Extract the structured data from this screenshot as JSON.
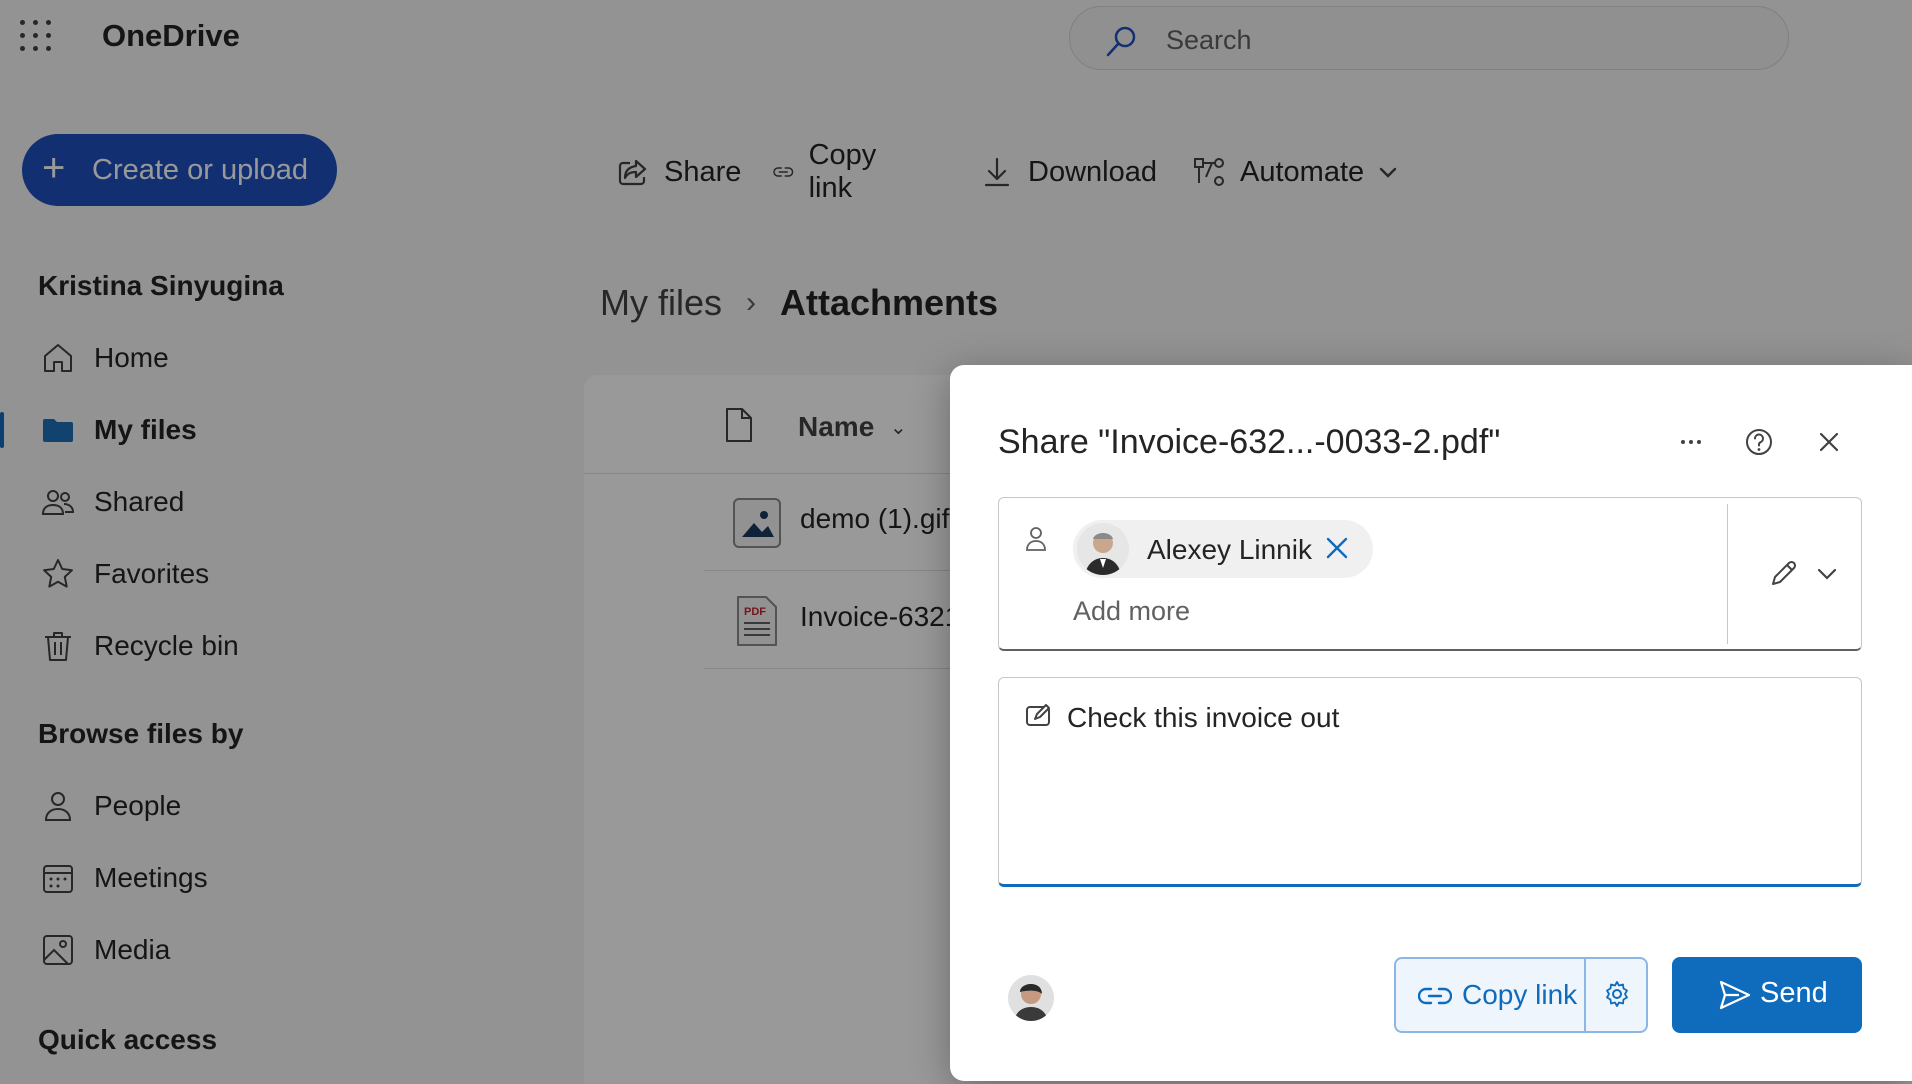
{
  "app": {
    "title": "OneDrive"
  },
  "search": {
    "placeholder": "Search"
  },
  "create": {
    "label": "Create or upload"
  },
  "toolbar": {
    "share": "Share",
    "copy_link": "Copy link",
    "download": "Download",
    "automate": "Automate"
  },
  "sidebar": {
    "user": "Kristina Sinyugina",
    "items": [
      {
        "label": "Home",
        "icon": "home-icon"
      },
      {
        "label": "My files",
        "icon": "folder-icon",
        "active": true
      },
      {
        "label": "Shared",
        "icon": "people-icon"
      },
      {
        "label": "Favorites",
        "icon": "star-icon"
      },
      {
        "label": "Recycle bin",
        "icon": "trash-icon"
      }
    ],
    "browse_heading": "Browse files by",
    "browse_items": [
      {
        "label": "People",
        "icon": "person-icon"
      },
      {
        "label": "Meetings",
        "icon": "calendar-icon"
      },
      {
        "label": "Media",
        "icon": "image-icon"
      }
    ],
    "quick_access": "Quick access"
  },
  "breadcrumb": {
    "parent": "My files",
    "current": "Attachments"
  },
  "files": {
    "column_name": "Name",
    "rows": [
      {
        "name": "demo (1).gif",
        "icon": "image-file-icon"
      },
      {
        "name": "Invoice-6321",
        "icon": "pdf-file-icon"
      }
    ]
  },
  "share_dialog": {
    "title": "Share \"Invoice-632...-0033-2.pdf\"",
    "recipient": "Alexey Linnik",
    "add_more": "Add more",
    "message": "Check this invoice out",
    "copy_link": "Copy link",
    "send": "Send"
  },
  "colors": {
    "accent": "#0f6cbd",
    "create_button": "#1f4fbf"
  }
}
